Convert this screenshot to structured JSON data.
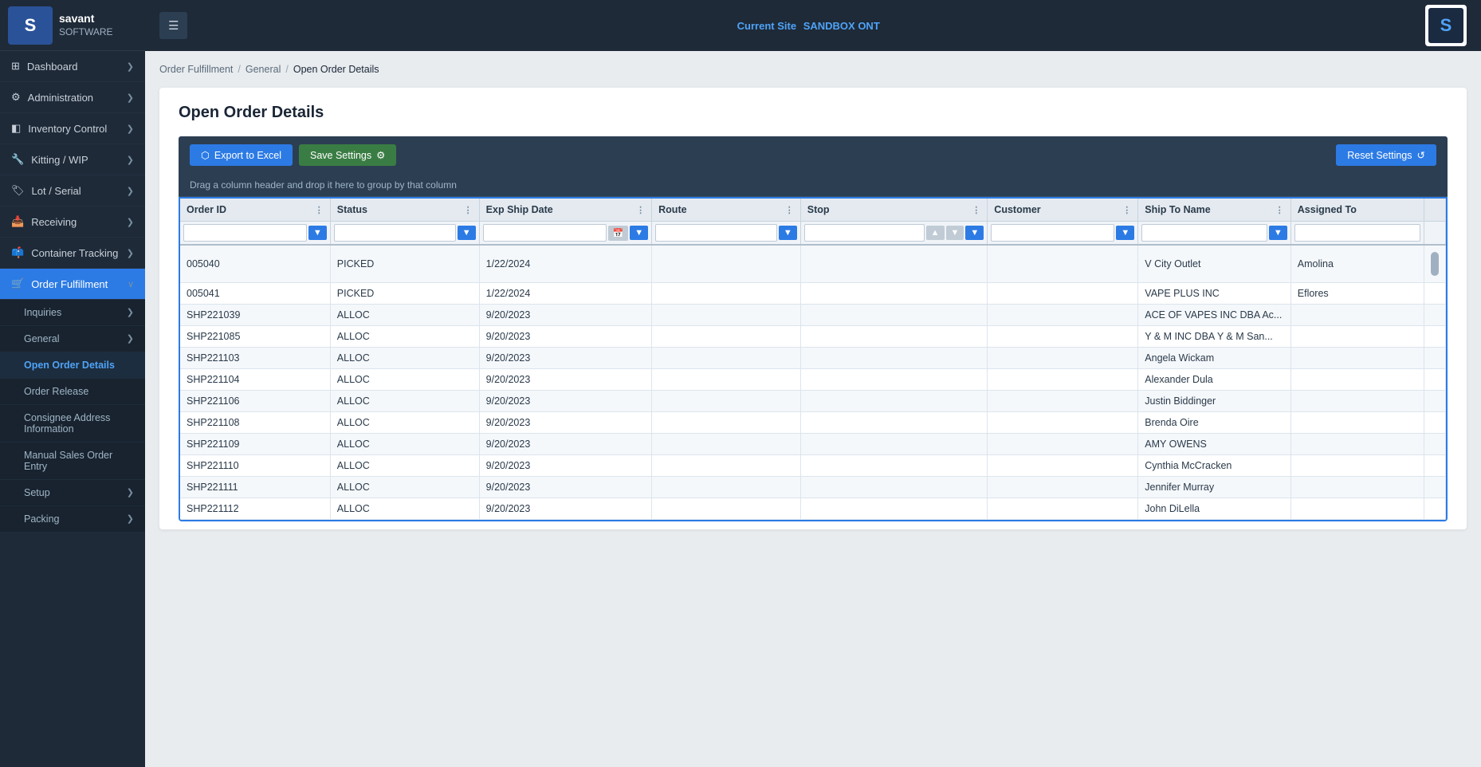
{
  "logo": {
    "abbr": "S",
    "line1": "savant",
    "line2": "SOFTWARE"
  },
  "topbar": {
    "hamburger_label": "☰",
    "site_label": "Current Site",
    "site_name": "SANDBOX ONT"
  },
  "sidebar": {
    "items": [
      {
        "id": "dashboard",
        "icon": "⊞",
        "label": "Dashboard",
        "hasChevron": true
      },
      {
        "id": "administration",
        "icon": "⚙",
        "label": "Administration",
        "hasChevron": true
      },
      {
        "id": "inventory-control",
        "icon": "📦",
        "label": "Inventory Control",
        "hasChevron": true
      },
      {
        "id": "kitting-wip",
        "icon": "🔧",
        "label": "Kitting / WIP",
        "hasChevron": true
      },
      {
        "id": "lot-serial",
        "icon": "🏷",
        "label": "Lot / Serial",
        "hasChevron": true
      },
      {
        "id": "receiving",
        "icon": "📥",
        "label": "Receiving",
        "hasChevron": true
      },
      {
        "id": "container-tracking",
        "icon": "📫",
        "label": "Container Tracking",
        "hasChevron": true
      },
      {
        "id": "order-fulfillment",
        "icon": "🛒",
        "label": "Order Fulfillment",
        "hasChevron": true,
        "active": true
      }
    ],
    "order_fulfillment_sub": [
      {
        "id": "inquiries",
        "label": "Inquiries",
        "hasChevron": true
      },
      {
        "id": "general",
        "label": "General",
        "hasChevron": true,
        "active": false
      },
      {
        "id": "open-order-details",
        "label": "Open Order Details",
        "active": true
      },
      {
        "id": "order-release",
        "label": "Order Release"
      },
      {
        "id": "consignee-address",
        "label": "Consignee Address Information"
      },
      {
        "id": "manual-sales-order",
        "label": "Manual Sales Order Entry"
      },
      {
        "id": "setup",
        "label": "Setup",
        "hasChevron": true
      },
      {
        "id": "packing",
        "label": "Packing",
        "hasChevron": true
      }
    ]
  },
  "breadcrumb": {
    "items": [
      "Order Fulfillment",
      "General",
      "Open Order Details"
    ]
  },
  "page": {
    "title": "Open Order Details"
  },
  "toolbar": {
    "export_label": "Export to Excel",
    "save_label": "Save Settings",
    "reset_label": "Reset Settings",
    "drag_hint": "Drag a column header and drop it here to group by that column"
  },
  "grid": {
    "columns": [
      {
        "id": "order-id",
        "label": "Order ID"
      },
      {
        "id": "status",
        "label": "Status"
      },
      {
        "id": "exp-ship-date",
        "label": "Exp Ship Date"
      },
      {
        "id": "route",
        "label": "Route"
      },
      {
        "id": "stop",
        "label": "Stop"
      },
      {
        "id": "customer",
        "label": "Customer"
      },
      {
        "id": "ship-to-name",
        "label": "Ship To Name"
      },
      {
        "id": "assigned-to",
        "label": "Assigned To"
      }
    ],
    "rows": [
      {
        "order_id": "005040",
        "status": "PICKED",
        "exp_ship_date": "1/22/2024",
        "route": "",
        "stop": "",
        "customer": "",
        "ship_to_name": "V City Outlet",
        "assigned_to": "Amolina"
      },
      {
        "order_id": "005041",
        "status": "PICKED",
        "exp_ship_date": "1/22/2024",
        "route": "",
        "stop": "",
        "customer": "",
        "ship_to_name": "VAPE PLUS INC",
        "assigned_to": "Eflores"
      },
      {
        "order_id": "SHP221039",
        "status": "ALLOC",
        "exp_ship_date": "9/20/2023",
        "route": "",
        "stop": "",
        "customer": "",
        "ship_to_name": "ACE OF VAPES INC DBA Ac...",
        "assigned_to": ""
      },
      {
        "order_id": "SHP221085",
        "status": "ALLOC",
        "exp_ship_date": "9/20/2023",
        "route": "",
        "stop": "",
        "customer": "",
        "ship_to_name": "Y & M INC DBA Y & M San...",
        "assigned_to": ""
      },
      {
        "order_id": "SHP221103",
        "status": "ALLOC",
        "exp_ship_date": "9/20/2023",
        "route": "",
        "stop": "",
        "customer": "",
        "ship_to_name": "Angela Wickam",
        "assigned_to": ""
      },
      {
        "order_id": "SHP221104",
        "status": "ALLOC",
        "exp_ship_date": "9/20/2023",
        "route": "",
        "stop": "",
        "customer": "",
        "ship_to_name": "Alexander Dula",
        "assigned_to": ""
      },
      {
        "order_id": "SHP221106",
        "status": "ALLOC",
        "exp_ship_date": "9/20/2023",
        "route": "",
        "stop": "",
        "customer": "",
        "ship_to_name": "Justin Biddinger",
        "assigned_to": ""
      },
      {
        "order_id": "SHP221108",
        "status": "ALLOC",
        "exp_ship_date": "9/20/2023",
        "route": "",
        "stop": "",
        "customer": "",
        "ship_to_name": "Brenda Oire",
        "assigned_to": ""
      },
      {
        "order_id": "SHP221109",
        "status": "ALLOC",
        "exp_ship_date": "9/20/2023",
        "route": "",
        "stop": "",
        "customer": "",
        "ship_to_name": "AMY OWENS",
        "assigned_to": ""
      },
      {
        "order_id": "SHP221110",
        "status": "ALLOC",
        "exp_ship_date": "9/20/2023",
        "route": "",
        "stop": "",
        "customer": "",
        "ship_to_name": "Cynthia McCracken",
        "assigned_to": ""
      },
      {
        "order_id": "SHP221111",
        "status": "ALLOC",
        "exp_ship_date": "9/20/2023",
        "route": "",
        "stop": "",
        "customer": "",
        "ship_to_name": "Jennifer Murray",
        "assigned_to": ""
      },
      {
        "order_id": "SHP221112",
        "status": "ALLOC",
        "exp_ship_date": "9/20/2023",
        "route": "",
        "stop": "",
        "customer": "",
        "ship_to_name": "John DiLella",
        "assigned_to": ""
      }
    ]
  }
}
